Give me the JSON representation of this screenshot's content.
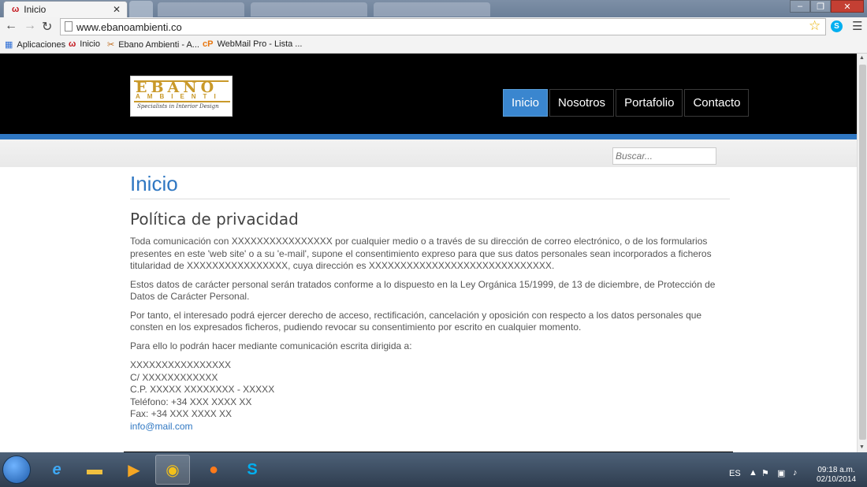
{
  "browser": {
    "active_tab_title": "Inicio",
    "url": "www.ebanoambienti.co",
    "bookmarks": [
      {
        "label": "Aplicaciones",
        "icon": "apps-grid-icon"
      },
      {
        "label": "Inicio",
        "icon": "ebano-favicon-icon"
      },
      {
        "label": "Ebano Ambienti - A...",
        "icon": "ebano-tools-icon"
      },
      {
        "label": "WebMail Pro - Lista ...",
        "icon": "cpanel-icon"
      }
    ]
  },
  "site": {
    "logo": {
      "wordmark": "EBANO",
      "sub": "AMBIENTI",
      "tagline": "Specialists in Interior Design"
    },
    "nav": [
      "Inicio",
      "Nosotros",
      "Portafolio",
      "Contacto"
    ],
    "active_nav": "Inicio",
    "search_placeholder": "Buscar..."
  },
  "content": {
    "page_title": "Inicio",
    "section_title": "Política de privacidad",
    "paragraphs": [
      "Toda comunicación con XXXXXXXXXXXXXXXX por cualquier medio o a través de su dirección de correo electrónico, o de los formularios presentes en este 'web site' o a su 'e-mail', supone el consentimiento expreso para que sus datos personales sean incorporados a ficheros titularidad de XXXXXXXXXXXXXXXX, cuya dirección es XXXXXXXXXXXXXXXXXXXXXXXXXXXXX.",
      "Estos datos de carácter personal serán tratados conforme a lo dispuesto en la Ley Orgánica 15/1999, de 13 de diciembre, de Protección de Datos de Carácter Personal.",
      "Por tanto, el interesado podrá ejercer derecho de acceso, rectificación, cancelación y oposición con respecto a los datos personales que consten en los expresados ficheros, pudiendo revocar su consentimiento por escrito en cualquier momento.",
      "Para ello lo podrán hacer mediante comunicación escrita dirigida a:"
    ],
    "address": [
      "XXXXXXXXXXXXXXXX",
      "C/ XXXXXXXXXXXX",
      "C.P. XXXXX XXXXXXXX - XXXXX",
      "Teléfono: +34 XXX XXXX XX",
      "Fax: +34 XXX XXXX XX"
    ],
    "email": "info@mail.com"
  },
  "taskbar": {
    "language": "ES",
    "time": "09:18 a.m.",
    "date": "02/10/2014"
  },
  "colors": {
    "accent": "#2f77c2",
    "header_bg": "#000000",
    "logo_gold": "#c9992a"
  }
}
